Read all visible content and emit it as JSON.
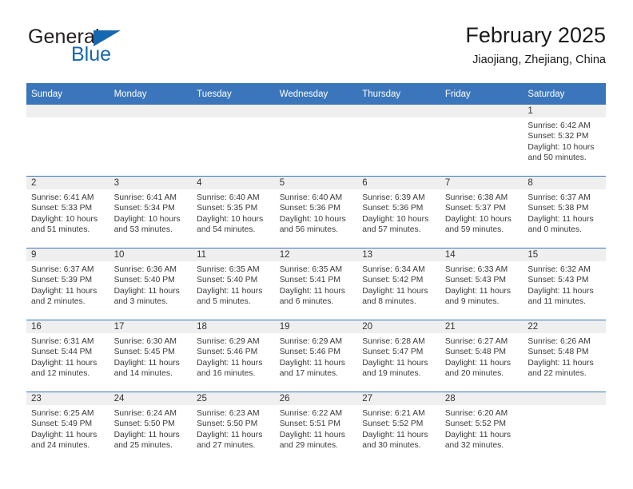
{
  "logo": {
    "word_top": "General",
    "word_bottom": "Blue",
    "triangle": "blue-triangle",
    "color_dark": "#231f20",
    "color_blue": "#1667b1"
  },
  "header": {
    "title": "February 2025",
    "subtitle": "Jiaojiang, Zhejiang, China"
  },
  "theme": {
    "header_blue": "#3b76bc",
    "daynum_band": "#efefef",
    "text": "#3a3a3a"
  },
  "weekdays": [
    "Sunday",
    "Monday",
    "Tuesday",
    "Wednesday",
    "Thursday",
    "Friday",
    "Saturday"
  ],
  "weeks": [
    [
      {
        "day": "",
        "sunrise": "",
        "sunset": "",
        "daylight": "",
        "empty": true
      },
      {
        "day": "",
        "sunrise": "",
        "sunset": "",
        "daylight": "",
        "empty": true
      },
      {
        "day": "",
        "sunrise": "",
        "sunset": "",
        "daylight": "",
        "empty": true
      },
      {
        "day": "",
        "sunrise": "",
        "sunset": "",
        "daylight": "",
        "empty": true
      },
      {
        "day": "",
        "sunrise": "",
        "sunset": "",
        "daylight": "",
        "empty": true
      },
      {
        "day": "",
        "sunrise": "",
        "sunset": "",
        "daylight": "",
        "empty": true
      },
      {
        "day": "1",
        "sunrise": "Sunrise: 6:42 AM",
        "sunset": "Sunset: 5:32 PM",
        "daylight": "Daylight: 10 hours and 50 minutes.",
        "empty": false
      }
    ],
    [
      {
        "day": "2",
        "sunrise": "Sunrise: 6:41 AM",
        "sunset": "Sunset: 5:33 PM",
        "daylight": "Daylight: 10 hours and 51 minutes.",
        "empty": false
      },
      {
        "day": "3",
        "sunrise": "Sunrise: 6:41 AM",
        "sunset": "Sunset: 5:34 PM",
        "daylight": "Daylight: 10 hours and 53 minutes.",
        "empty": false
      },
      {
        "day": "4",
        "sunrise": "Sunrise: 6:40 AM",
        "sunset": "Sunset: 5:35 PM",
        "daylight": "Daylight: 10 hours and 54 minutes.",
        "empty": false
      },
      {
        "day": "5",
        "sunrise": "Sunrise: 6:40 AM",
        "sunset": "Sunset: 5:36 PM",
        "daylight": "Daylight: 10 hours and 56 minutes.",
        "empty": false
      },
      {
        "day": "6",
        "sunrise": "Sunrise: 6:39 AM",
        "sunset": "Sunset: 5:36 PM",
        "daylight": "Daylight: 10 hours and 57 minutes.",
        "empty": false
      },
      {
        "day": "7",
        "sunrise": "Sunrise: 6:38 AM",
        "sunset": "Sunset: 5:37 PM",
        "daylight": "Daylight: 10 hours and 59 minutes.",
        "empty": false
      },
      {
        "day": "8",
        "sunrise": "Sunrise: 6:37 AM",
        "sunset": "Sunset: 5:38 PM",
        "daylight": "Daylight: 11 hours and 0 minutes.",
        "empty": false
      }
    ],
    [
      {
        "day": "9",
        "sunrise": "Sunrise: 6:37 AM",
        "sunset": "Sunset: 5:39 PM",
        "daylight": "Daylight: 11 hours and 2 minutes.",
        "empty": false
      },
      {
        "day": "10",
        "sunrise": "Sunrise: 6:36 AM",
        "sunset": "Sunset: 5:40 PM",
        "daylight": "Daylight: 11 hours and 3 minutes.",
        "empty": false
      },
      {
        "day": "11",
        "sunrise": "Sunrise: 6:35 AM",
        "sunset": "Sunset: 5:40 PM",
        "daylight": "Daylight: 11 hours and 5 minutes.",
        "empty": false
      },
      {
        "day": "12",
        "sunrise": "Sunrise: 6:35 AM",
        "sunset": "Sunset: 5:41 PM",
        "daylight": "Daylight: 11 hours and 6 minutes.",
        "empty": false
      },
      {
        "day": "13",
        "sunrise": "Sunrise: 6:34 AM",
        "sunset": "Sunset: 5:42 PM",
        "daylight": "Daylight: 11 hours and 8 minutes.",
        "empty": false
      },
      {
        "day": "14",
        "sunrise": "Sunrise: 6:33 AM",
        "sunset": "Sunset: 5:43 PM",
        "daylight": "Daylight: 11 hours and 9 minutes.",
        "empty": false
      },
      {
        "day": "15",
        "sunrise": "Sunrise: 6:32 AM",
        "sunset": "Sunset: 5:43 PM",
        "daylight": "Daylight: 11 hours and 11 minutes.",
        "empty": false
      }
    ],
    [
      {
        "day": "16",
        "sunrise": "Sunrise: 6:31 AM",
        "sunset": "Sunset: 5:44 PM",
        "daylight": "Daylight: 11 hours and 12 minutes.",
        "empty": false
      },
      {
        "day": "17",
        "sunrise": "Sunrise: 6:30 AM",
        "sunset": "Sunset: 5:45 PM",
        "daylight": "Daylight: 11 hours and 14 minutes.",
        "empty": false
      },
      {
        "day": "18",
        "sunrise": "Sunrise: 6:29 AM",
        "sunset": "Sunset: 5:46 PM",
        "daylight": "Daylight: 11 hours and 16 minutes.",
        "empty": false
      },
      {
        "day": "19",
        "sunrise": "Sunrise: 6:29 AM",
        "sunset": "Sunset: 5:46 PM",
        "daylight": "Daylight: 11 hours and 17 minutes.",
        "empty": false
      },
      {
        "day": "20",
        "sunrise": "Sunrise: 6:28 AM",
        "sunset": "Sunset: 5:47 PM",
        "daylight": "Daylight: 11 hours and 19 minutes.",
        "empty": false
      },
      {
        "day": "21",
        "sunrise": "Sunrise: 6:27 AM",
        "sunset": "Sunset: 5:48 PM",
        "daylight": "Daylight: 11 hours and 20 minutes.",
        "empty": false
      },
      {
        "day": "22",
        "sunrise": "Sunrise: 6:26 AM",
        "sunset": "Sunset: 5:48 PM",
        "daylight": "Daylight: 11 hours and 22 minutes.",
        "empty": false
      }
    ],
    [
      {
        "day": "23",
        "sunrise": "Sunrise: 6:25 AM",
        "sunset": "Sunset: 5:49 PM",
        "daylight": "Daylight: 11 hours and 24 minutes.",
        "empty": false
      },
      {
        "day": "24",
        "sunrise": "Sunrise: 6:24 AM",
        "sunset": "Sunset: 5:50 PM",
        "daylight": "Daylight: 11 hours and 25 minutes.",
        "empty": false
      },
      {
        "day": "25",
        "sunrise": "Sunrise: 6:23 AM",
        "sunset": "Sunset: 5:50 PM",
        "daylight": "Daylight: 11 hours and 27 minutes.",
        "empty": false
      },
      {
        "day": "26",
        "sunrise": "Sunrise: 6:22 AM",
        "sunset": "Sunset: 5:51 PM",
        "daylight": "Daylight: 11 hours and 29 minutes.",
        "empty": false
      },
      {
        "day": "27",
        "sunrise": "Sunrise: 6:21 AM",
        "sunset": "Sunset: 5:52 PM",
        "daylight": "Daylight: 11 hours and 30 minutes.",
        "empty": false
      },
      {
        "day": "28",
        "sunrise": "Sunrise: 6:20 AM",
        "sunset": "Sunset: 5:52 PM",
        "daylight": "Daylight: 11 hours and 32 minutes.",
        "empty": false
      },
      {
        "day": "",
        "sunrise": "",
        "sunset": "",
        "daylight": "",
        "empty": true
      }
    ]
  ]
}
